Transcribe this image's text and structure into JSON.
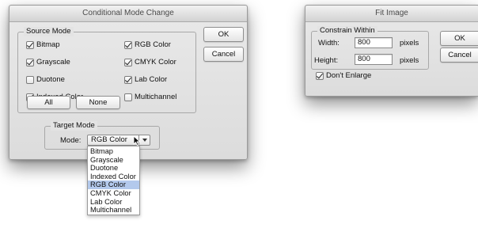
{
  "conditional_mode_change": {
    "title": "Conditional Mode Change",
    "source_mode": {
      "legend": "Source Mode",
      "options": [
        {
          "label": "Bitmap",
          "checked": true
        },
        {
          "label": "RGB Color",
          "checked": true
        },
        {
          "label": "Grayscale",
          "checked": true
        },
        {
          "label": "CMYK Color",
          "checked": true
        },
        {
          "label": "Duotone",
          "checked": false
        },
        {
          "label": "Lab Color",
          "checked": true
        },
        {
          "label": "Indexed Color",
          "checked": true
        },
        {
          "label": "Multichannel",
          "checked": false
        }
      ],
      "all_label": "All",
      "none_label": "None"
    },
    "target_mode": {
      "legend": "Target Mode",
      "mode_label": "Mode:",
      "selected": "RGB Color",
      "options": [
        "Bitmap",
        "Grayscale",
        "Duotone",
        "Indexed Color",
        "RGB Color",
        "CMYK Color",
        "Lab Color",
        "Multichannel"
      ]
    },
    "ok_label": "OK",
    "cancel_label": "Cancel"
  },
  "fit_image": {
    "title": "Fit Image",
    "legend": "Constrain Within",
    "width_label": "Width:",
    "width_value": "800",
    "width_unit": "pixels",
    "height_label": "Height:",
    "height_value": "800",
    "height_unit": "pixels",
    "dont_enlarge_label": "Don't Enlarge",
    "dont_enlarge_checked": true,
    "ok_label": "OK",
    "cancel_label": "Cancel"
  }
}
